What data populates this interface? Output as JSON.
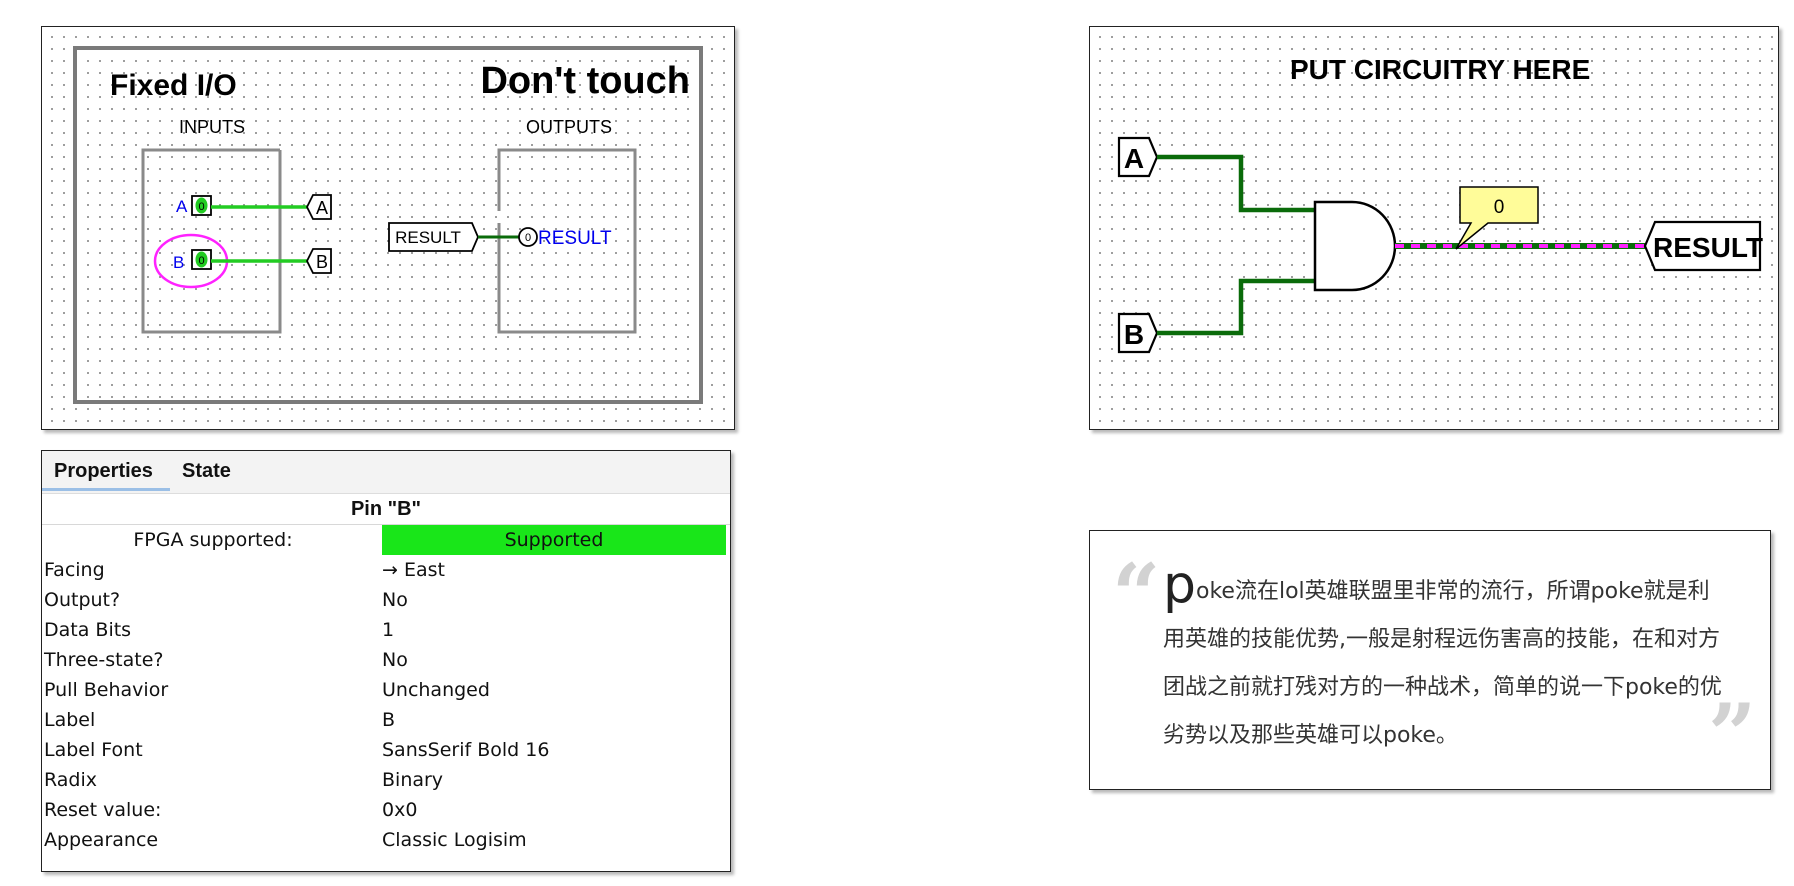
{
  "left_canvas": {
    "title": "Fixed I/O",
    "warning": "Don't touch",
    "inputs_label": "INPUTS",
    "outputs_label": "OUTPUTS",
    "pin_a_label": "A",
    "pin_b_label": "B",
    "pin_a_value": "0",
    "pin_b_value": "0",
    "tunnel_a": "A",
    "tunnel_b": "B",
    "tunnel_result": "RESULT",
    "output_pin_value": "0",
    "output_label": "RESULT"
  },
  "right_canvas": {
    "heading": "PUT CIRCUITRY HERE",
    "tunnel_a": "A",
    "tunnel_b": "B",
    "tunnel_result": "RESULT",
    "probe_value": "0"
  },
  "properties": {
    "tabs": [
      "Properties",
      "State"
    ],
    "active_tab": "Properties",
    "component_title": "Pin \"B\"",
    "rows": [
      {
        "name": "FPGA supported:",
        "value": "Supported"
      },
      {
        "name": "Facing",
        "value": "→ East"
      },
      {
        "name": "Output?",
        "value": "No"
      },
      {
        "name": "Data Bits",
        "value": "1"
      },
      {
        "name": "Three-state?",
        "value": "No"
      },
      {
        "name": "Pull Behavior",
        "value": "Unchanged"
      },
      {
        "name": "Label",
        "value": "B"
      },
      {
        "name": "Label Font",
        "value": "SansSerif Bold 16"
      },
      {
        "name": "Radix",
        "value": "Binary"
      },
      {
        "name": "Reset value:",
        "value": "0x0"
      },
      {
        "name": "Appearance",
        "value": "Classic Logisim"
      }
    ]
  },
  "quote": {
    "open_mark": "“",
    "close_mark": "”",
    "drop_letter": "p",
    "text": "oke流在lol英雄联盟里非常的流行，所谓poke就是利用英雄的技能优势,一般是射程远伤害高的技能，在和对方团战之前就打残对方的一种战术，简单的说一下poke的优劣势以及那些英雄可以poke。"
  },
  "colors": {
    "wire_on": "#22cc22",
    "wire_dark": "#0a6b0a",
    "highlight": "#ff22ff",
    "label_blue": "#0000ee",
    "supported_green": "#19e619",
    "probe_yellow": "#fffc99"
  }
}
